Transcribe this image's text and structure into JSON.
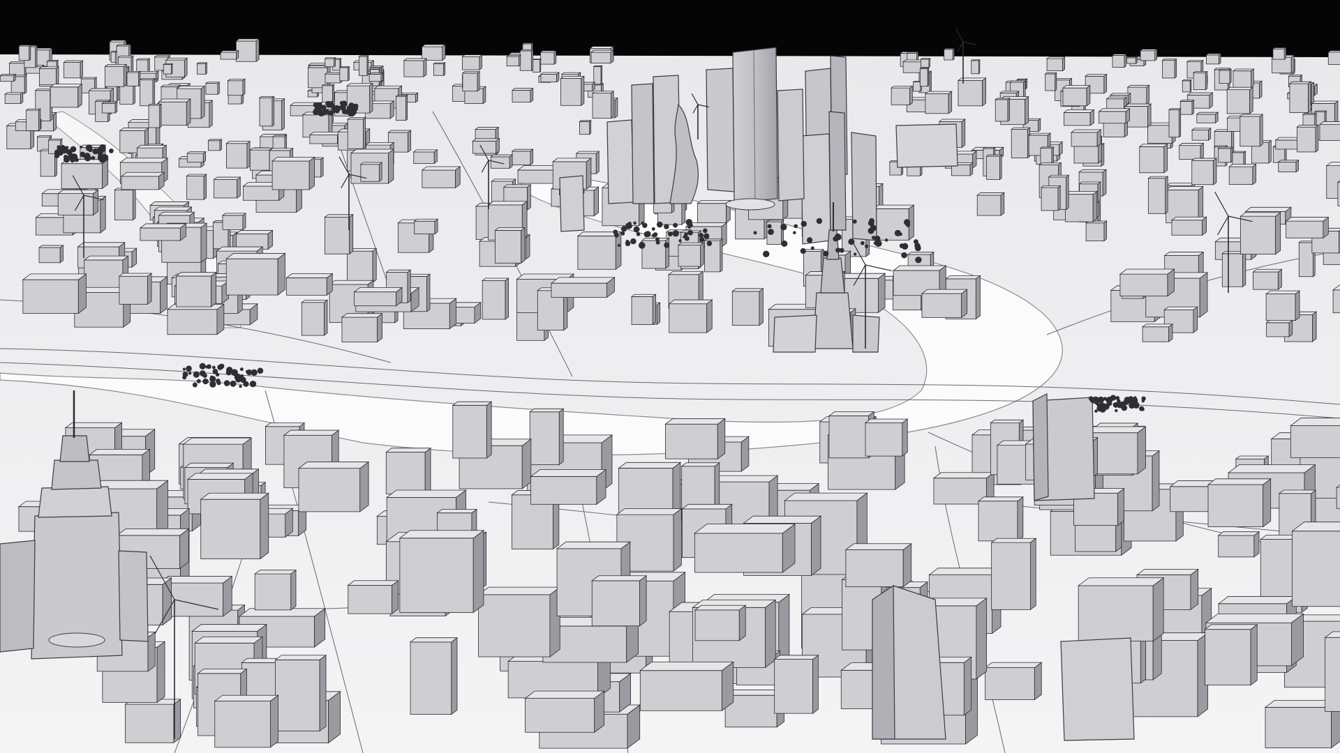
{
  "scene": {
    "kind": "city-3d-render",
    "style": "white clay model",
    "palette": {
      "background": "#050505",
      "ground": "#f5f5f5",
      "river": "#fbfbfb",
      "building_light": "#e6e6e8",
      "building_mid": "#cfcfd3",
      "building_dark": "#9a9aa0",
      "shadow": "#b9b9be",
      "lines": "#2b2b2f",
      "trees": "#2f2f33"
    },
    "features": {
      "river_bend": "present",
      "skyscraper_cluster": "present",
      "stalinist_towers": "present",
      "wind_turbines": "present",
      "dense_lowrise_blocks": "present"
    }
  }
}
